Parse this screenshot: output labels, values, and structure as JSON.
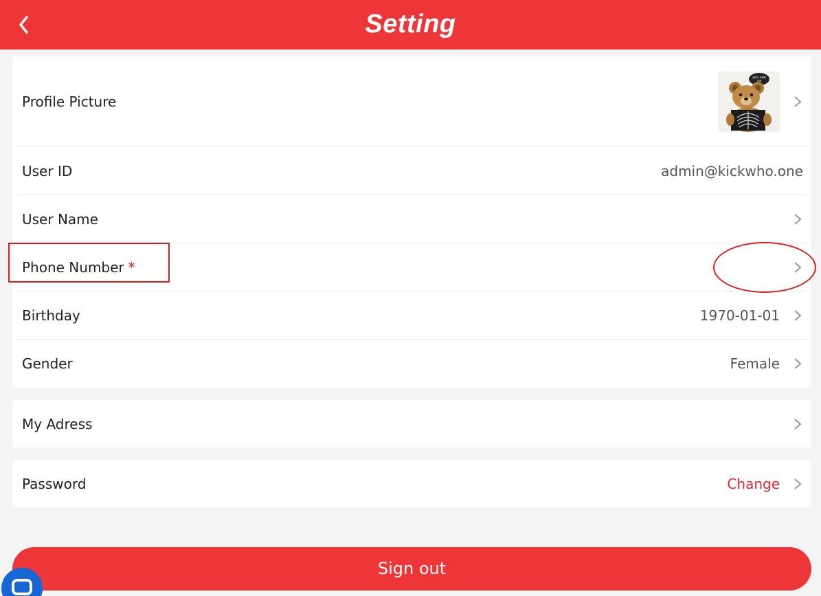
{
  "header": {
    "title": "Setting",
    "back_icon": "chevron-left-icon",
    "bg_color": "#ee3537"
  },
  "profile": {
    "label": "Profile Picture",
    "avatar_alt": "teddy bear with x-ray",
    "avatar_speech": "you see me"
  },
  "rows": {
    "user_id": {
      "label": "User ID",
      "value": "admin@kickwho.one"
    },
    "user_name": {
      "label": "User Name",
      "value": ""
    },
    "phone": {
      "label": "Phone Number",
      "required_mark": "*",
      "value": ""
    },
    "birthday": {
      "label": "Birthday",
      "value": "1970-01-01"
    },
    "gender": {
      "label": "Gender",
      "value": "Female"
    },
    "address": {
      "label": "My Adress"
    },
    "password": {
      "label": "Password",
      "action": "Change"
    }
  },
  "signout": {
    "label": "Sign out"
  },
  "chat": {
    "icon": "chat-bubble-icon",
    "color": "#1766d6"
  },
  "annotations": {
    "color": "#e01b1b"
  }
}
